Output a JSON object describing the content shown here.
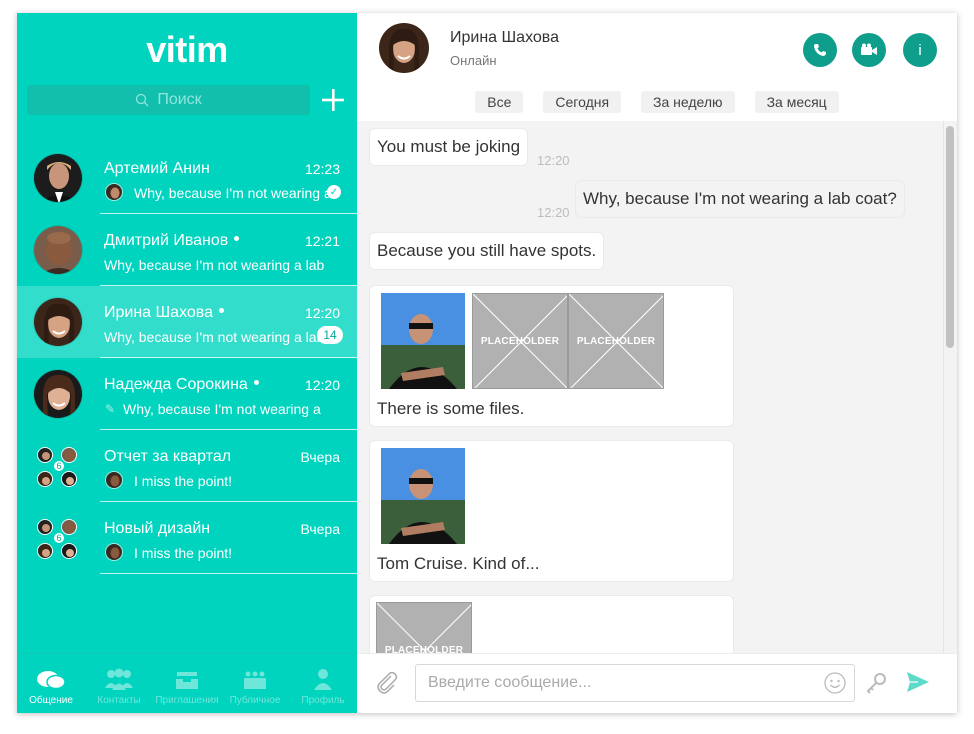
{
  "app": {
    "logo": "vitim"
  },
  "search": {
    "placeholder": "Поиск"
  },
  "chats": [
    {
      "name": "Артемий Анин",
      "time": "12:23",
      "preview": "Why, because I'm not wearing a lab coat?",
      "online": false,
      "read": true
    },
    {
      "name": "Дмитрий Иванов",
      "time": "12:21",
      "preview": "Why, because I'm not wearing a lab",
      "online": true
    },
    {
      "name": "Ирина Шахова",
      "time": "12:20",
      "preview": "Why, because I'm not wearing a lab",
      "online": true,
      "unread": "14"
    },
    {
      "name": "Надежда Сорокина",
      "time": "12:20",
      "preview": "Why, because I'm not wearing a",
      "online": true
    },
    {
      "name": "Отчет за квартал",
      "time": "Вчера",
      "preview": "I miss the point!",
      "members": "6"
    },
    {
      "name": "Новый дизайн",
      "time": "Вчера",
      "preview": "I miss the point!",
      "members": "6"
    }
  ],
  "nav": [
    {
      "label": "Общение",
      "icon": "chat-bubbles-icon",
      "active": true
    },
    {
      "label": "Контакты",
      "icon": "contacts-icon"
    },
    {
      "label": "Приглашения",
      "icon": "inbox-icon"
    },
    {
      "label": "Публичное",
      "icon": "public-icon"
    },
    {
      "label": "Профиль",
      "icon": "profile-icon"
    }
  ],
  "header": {
    "name": "Ирина Шахова",
    "status": "Онлайн"
  },
  "filters": [
    "Все",
    "Сегодня",
    "За неделю",
    "За месяц"
  ],
  "messages": [
    {
      "text": "You must be joking",
      "time": "12:20",
      "mine": false
    },
    {
      "text": "Why, because I'm not wearing a lab coat?",
      "time": "12:20",
      "mine": true
    },
    {
      "text": "Because you still have spots.",
      "mine": false
    }
  ],
  "cards": [
    {
      "caption": "There is some files.",
      "placeholders": [
        "PLACEHOLDER",
        "PLACEHOLDER"
      ]
    },
    {
      "caption": "Tom Cruise. Kind of..."
    },
    {
      "placeholders": [
        "PLACEHOLDER"
      ]
    }
  ],
  "composer": {
    "placeholder": "Введите сообщение..."
  },
  "colors": {
    "sidebar": "#00d4bf",
    "accent": "#0f9e8c",
    "send": "#5fd9c9"
  }
}
